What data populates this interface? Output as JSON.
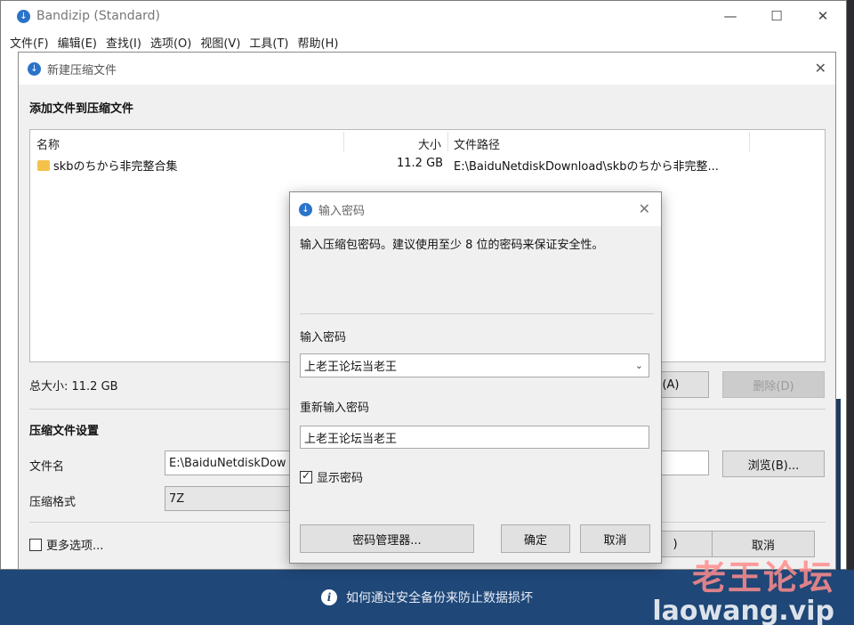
{
  "app": {
    "title": "Bandizip (Standard)",
    "logo_glyph": "↓",
    "controls": {
      "minimize": "—",
      "maximize": "☐",
      "close": "✕"
    },
    "menu": [
      "文件(F)",
      "编辑(E)",
      "查找(I)",
      "选项(O)",
      "视图(V)",
      "工具(T)",
      "帮助(H)"
    ]
  },
  "new_archive": {
    "title": "新建压缩文件",
    "close": "✕",
    "add_files_heading": "添加文件到压缩文件",
    "columns": {
      "name": "名称",
      "size": "大小",
      "path": "文件路径"
    },
    "rows": [
      {
        "name": "skbのちから非完整合集",
        "size": "11.2 GB",
        "path": "E:\\BaiduNetdiskDownload\\skbのちから非完整..."
      }
    ],
    "total_size": "总大小: 11.2 GB",
    "add_button": "(A)",
    "delete_button": "删除(D)",
    "settings_heading": "压缩文件设置",
    "filename_label": "文件名",
    "filename_value": "E:\\BaiduNetdiskDow",
    "browse_button": "浏览(B)...",
    "format_label": "压缩格式",
    "format_value": "7Z",
    "more_options": "更多选项...",
    "start_button_fragment": ")",
    "cancel_button": "取消"
  },
  "password_dialog": {
    "title": "输入密码",
    "close": "✕",
    "description": "输入压缩包密码。建议使用至少 8 位的密码来保证安全性。",
    "password_label": "输入密码",
    "password_value": "上老王论坛当老王",
    "confirm_label": "重新输入密码",
    "confirm_value": "上老王论坛当老王",
    "show_password": "显示密码",
    "show_password_checked": true,
    "manager_button": "密码管理器...",
    "ok_button": "确定",
    "cancel_button": "取消"
  },
  "info_bar": {
    "text": "如何通过安全备份来防止数据损坏",
    "icon": "i"
  },
  "watermark": {
    "line1": "老王论坛",
    "line2": "laowang.vip"
  }
}
